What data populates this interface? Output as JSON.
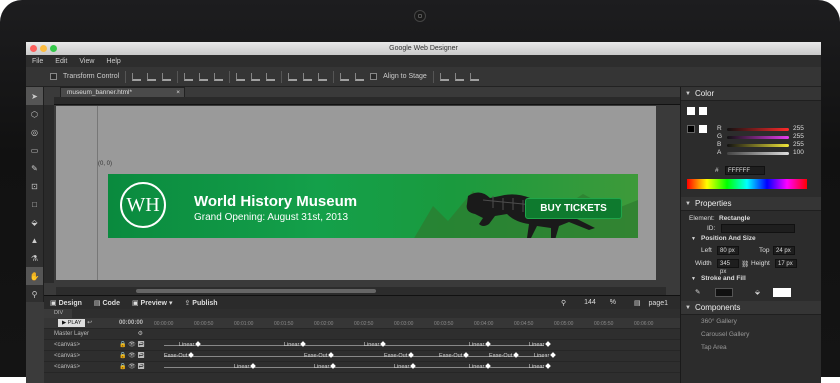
{
  "window": {
    "title": "Google Web Designer"
  },
  "menu": [
    "File",
    "Edit",
    "View",
    "Help"
  ],
  "toolbar": {
    "transform_control": "Transform Control",
    "align_to_stage": "Align to Stage"
  },
  "document": {
    "tab_name": "museum_banner.html*",
    "close": "×",
    "origin_label": "(0, 0)"
  },
  "banner": {
    "logo_text": "WH",
    "title": "World History Museum",
    "subtitle": "Grand Opening: August 31st, 2013",
    "cta": "BUY TICKETS"
  },
  "view_bar": {
    "design": "Design",
    "code": "Code",
    "preview": "Preview",
    "publish": "Publish",
    "zoom": "144",
    "zoom_unit": "%",
    "page": "page1"
  },
  "timeline": {
    "tab": "DIV",
    "play": "▶ PLAY",
    "time": "00:00:00",
    "ticks": [
      "00:00:00",
      "00:00:50",
      "00:01:00",
      "00:01:50",
      "00:02:00",
      "00:02:50",
      "00:03:00",
      "00:03:50",
      "00:04:00",
      "00:04:50",
      "00:05:00",
      "00:05:50",
      "00:06:00"
    ],
    "master_layer": "Master Layer",
    "rows": [
      {
        "name": "<canvas>",
        "keys": [
          "Linear",
          "Linear",
          "Linear",
          "Linear",
          "Linear"
        ]
      },
      {
        "name": "<canvas>",
        "keys": [
          "Ease-Out",
          "Ease-Out",
          "Ease-Out",
          "Ease-Out",
          "Ease-Out",
          "Linear"
        ]
      },
      {
        "name": "<canvas>",
        "keys": [
          "Linear",
          "Linear",
          "Linear",
          "Linear",
          "Linear"
        ]
      }
    ]
  },
  "color_panel": {
    "title": "Color",
    "channels": [
      {
        "label": "R",
        "value": "255",
        "color": "#ff2a2a"
      },
      {
        "label": "G",
        "value": "255",
        "color": "#e63df0"
      },
      {
        "label": "B",
        "value": "255",
        "color": "#f0e63a"
      },
      {
        "label": "A",
        "value": "100",
        "color": "#2a2a2a"
      }
    ],
    "hash": "#",
    "hex": "FFFFFF"
  },
  "properties": {
    "title": "Properties",
    "element_label": "Element:",
    "element_value": "Rectangle",
    "id_label": "ID:",
    "position_size": "Position And Size",
    "left_label": "Left",
    "left_value": "80",
    "left_unit": "px",
    "top_label": "Top",
    "top_value": "24",
    "top_unit": "px",
    "width_label": "Width",
    "width_value": "345",
    "width_unit": "px",
    "height_label": "Height",
    "height_value": "17",
    "height_unit": "px",
    "stroke_fill": "Stroke and Fill"
  },
  "components": {
    "title": "Components",
    "items": [
      "360° Gallery",
      "Carousel Gallery",
      "Tap Area"
    ]
  },
  "colors": {
    "banner_green": "#14a04a",
    "stage_gray": "#9a9a9a",
    "panel_dark": "#2c2c2c"
  }
}
